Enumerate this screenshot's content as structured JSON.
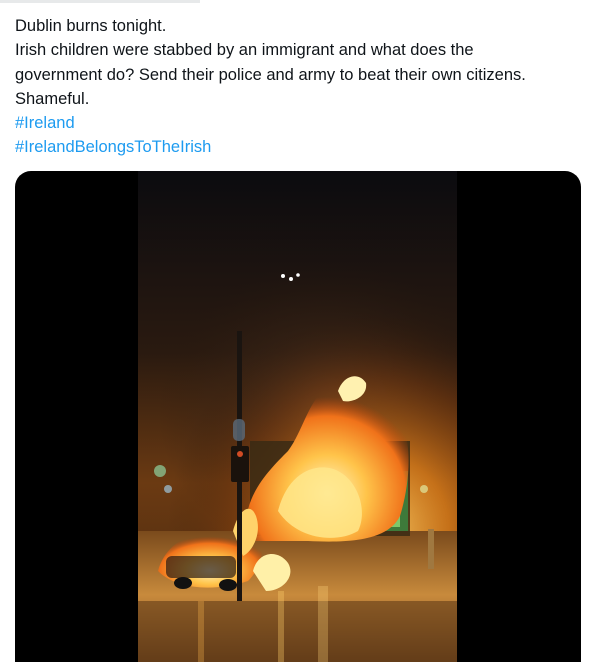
{
  "tweet": {
    "lines": [
      "Dublin burns tonight.",
      "Irish children were stabbed by an immigrant and what does the",
      "government do? Send their police and  army to beat their own citizens.",
      "Shameful."
    ],
    "hashtags": [
      "#Ireland",
      "#IrelandBelongsToTheIrish"
    ]
  },
  "colors": {
    "link": "#1d9bf0",
    "text": "#0f1419",
    "media_background": "#000000"
  },
  "media": {
    "type": "video",
    "subject": "burning bus and car on a city street at night"
  }
}
